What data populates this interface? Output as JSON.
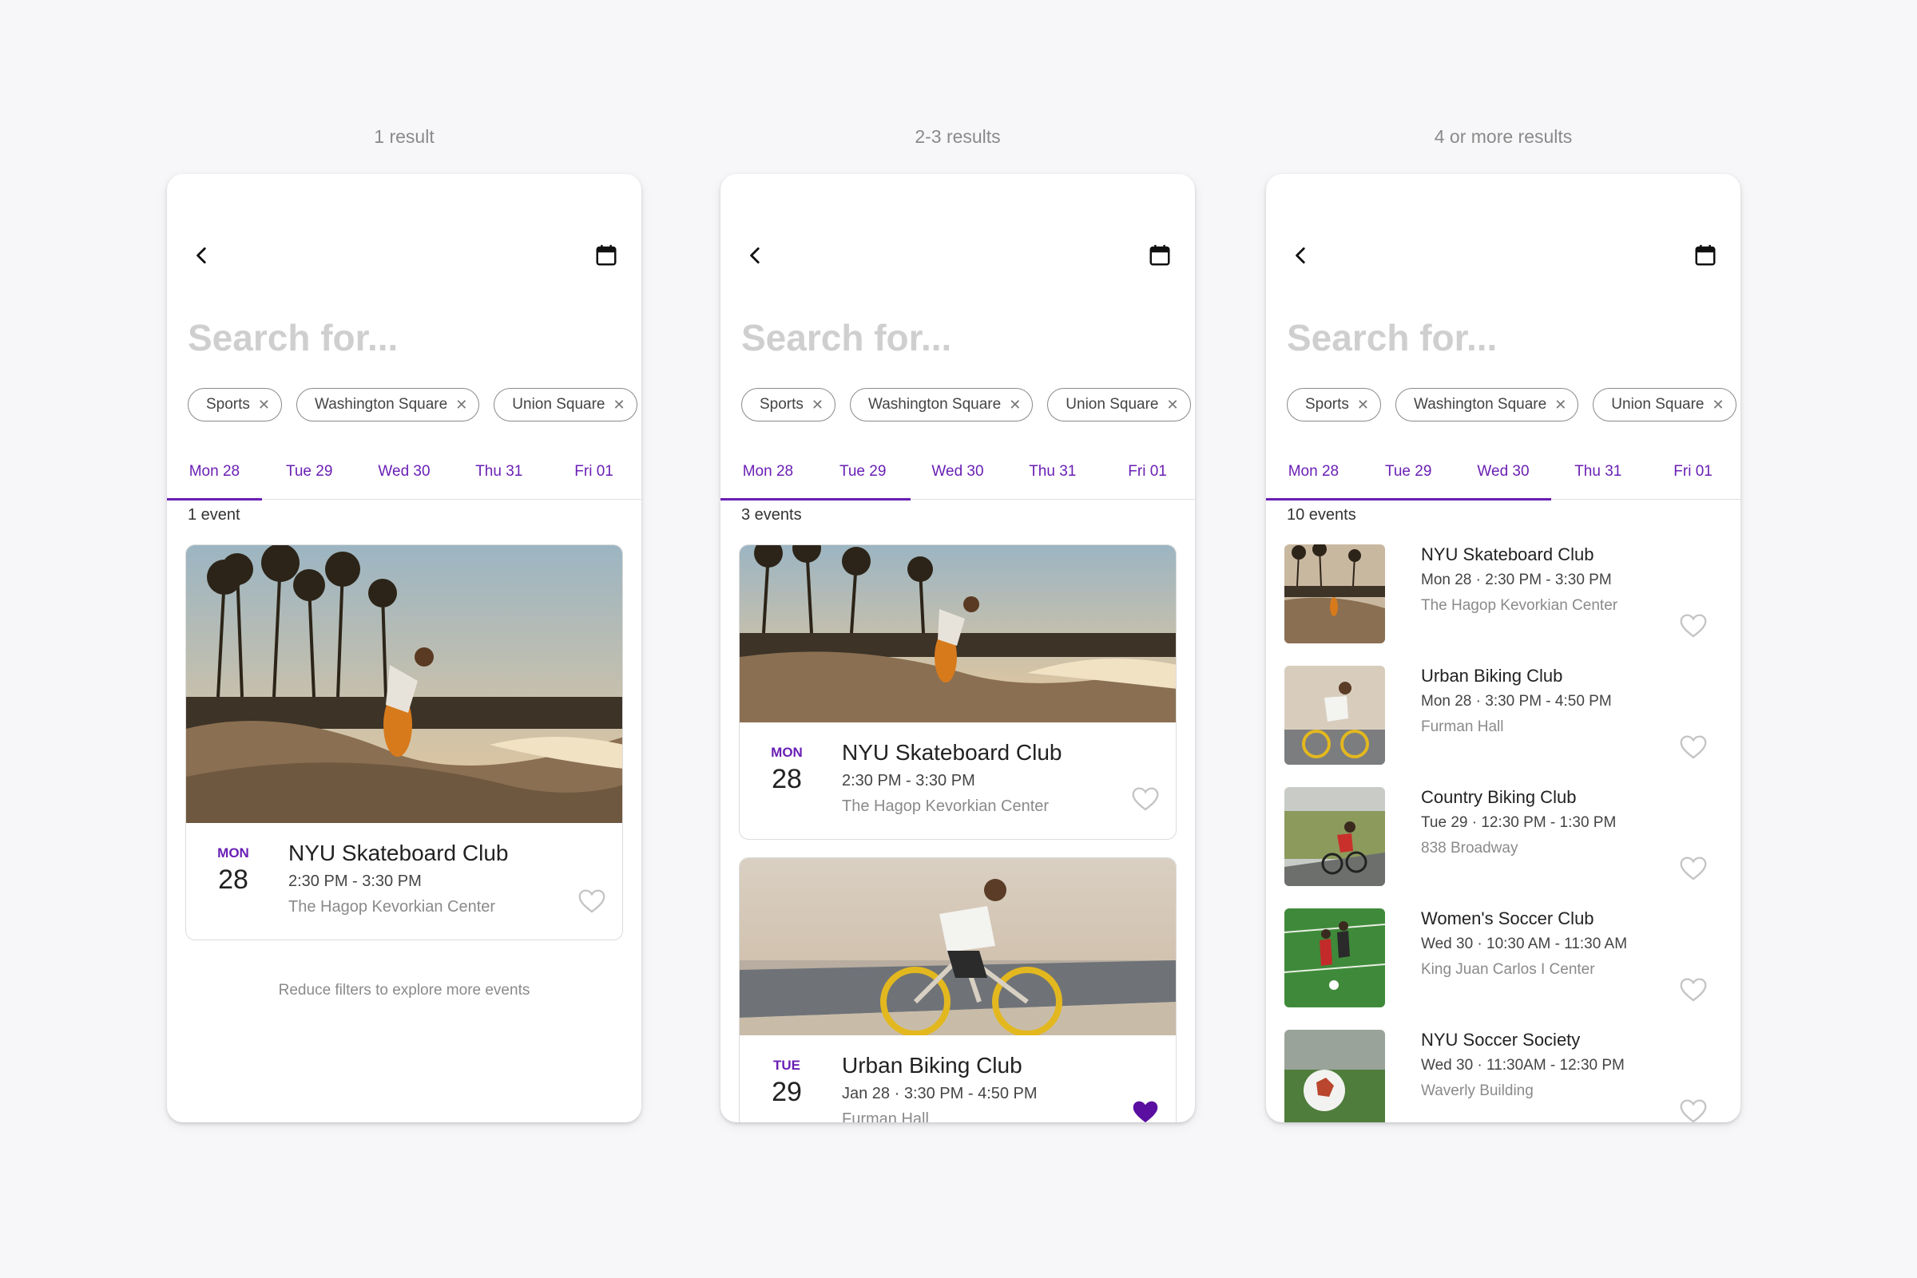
{
  "columns": [
    {
      "label": "1 result"
    },
    {
      "label": "2-3 results"
    },
    {
      "label": "4 or more results"
    }
  ],
  "search_placeholder": "Search for...",
  "chips": [
    "Sports",
    "Washington Square",
    "Union Square"
  ],
  "days": [
    "Mon 28",
    "Tue 29",
    "Wed 30",
    "Thu 31",
    "Fri 01"
  ],
  "accent": "#6a1fb5",
  "screen1": {
    "count": "1 event",
    "card": {
      "dow": "MON",
      "day": "28",
      "title": "NYU Skateboard Club",
      "time": "2:30 PM - 3:30 PM",
      "venue": "The Hagop Kevorkian Center"
    },
    "hint": "Reduce filters to explore more events"
  },
  "screen2": {
    "count": "3 events",
    "cards": [
      {
        "dow": "MON",
        "day": "28",
        "title": "NYU Skateboard Club",
        "time": "2:30 PM - 3:30 PM",
        "venue": "The Hagop Kevorkian Center",
        "liked": false
      },
      {
        "dow": "TUE",
        "day": "29",
        "title": "Urban Biking Club",
        "time": "Jan 28 · 3:30 PM - 4:50 PM",
        "venue": "Furman Hall",
        "liked": true
      }
    ]
  },
  "screen3": {
    "count": "10 events",
    "items": [
      {
        "title": "NYU Skateboard Club",
        "time": "Mon 28 · 2:30 PM - 3:30 PM",
        "venue": "The Hagop Kevorkian Center"
      },
      {
        "title": "Urban Biking Club",
        "time": "Mon 28 · 3:30 PM - 4:50 PM",
        "venue": "Furman Hall"
      },
      {
        "title": "Country Biking Club",
        "time": "Tue 29 · 12:30 PM - 1:30 PM",
        "venue": "838 Broadway"
      },
      {
        "title": "Women's Soccer Club",
        "time": "Wed 30 · 10:30 AM - 11:30 AM",
        "venue": "King Juan Carlos I Center"
      },
      {
        "title": "NYU Soccer Society",
        "time": "Wed 30 · 11:30AM - 12:30 PM",
        "venue": "Waverly Building"
      }
    ]
  }
}
